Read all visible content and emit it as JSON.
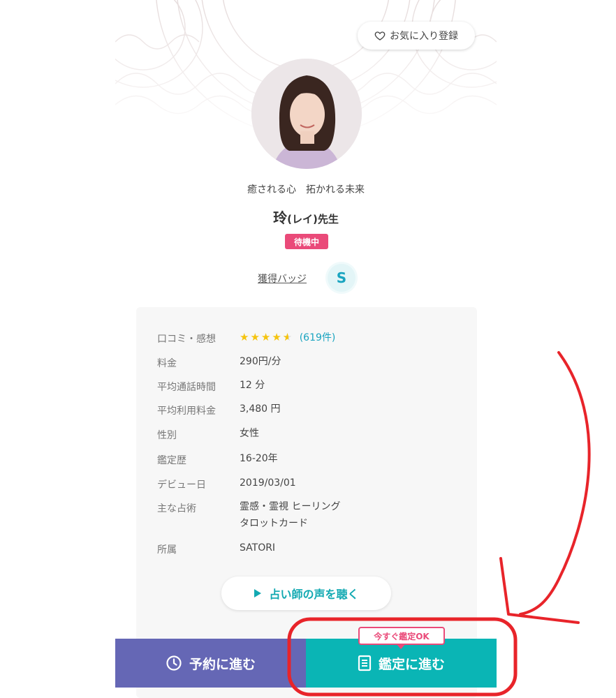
{
  "favorite_button": {
    "label": "お気に入り登録",
    "icon": "heart-outline-icon"
  },
  "profile": {
    "catchphrase": "癒される心　拓かれる未来",
    "name_main": "玲",
    "name_reading": "(レイ)先生",
    "status": "待機中",
    "status_color": "#ea4a79"
  },
  "badges": {
    "label": "獲得バッジ",
    "badge_letter": "S"
  },
  "details": [
    {
      "label": "口コミ・感想",
      "value": "",
      "rating": 4.5,
      "stars": "★★★★★",
      "count": "(619件)"
    },
    {
      "label": "料金",
      "value": "290円/分"
    },
    {
      "label": "平均通話時間",
      "value": "12 分"
    },
    {
      "label": "平均利用料金",
      "value": "3,480 円"
    },
    {
      "label": "性別",
      "value": "女性"
    },
    {
      "label": "鑑定歴",
      "value": "16-20年"
    },
    {
      "label": "デビュー日",
      "value": "2019/03/01"
    },
    {
      "label": "主な占術",
      "value": "霊感・霊視  ヒーリング",
      "value2": "タロットカード"
    },
    {
      "label": "所属",
      "value": "SATORI"
    }
  ],
  "voice_button": {
    "label": "占い師の声を聴く"
  },
  "bottom_bar": {
    "reserve_label": "予約に進む",
    "consult_label": "鑑定に進む",
    "now_tag": "今すぐ鑑定OK"
  },
  "colors": {
    "reserve": "#6567b5",
    "consult": "#0ab5b5",
    "accent_pink": "#ea4a79",
    "annotation_red": "#e8242a"
  }
}
